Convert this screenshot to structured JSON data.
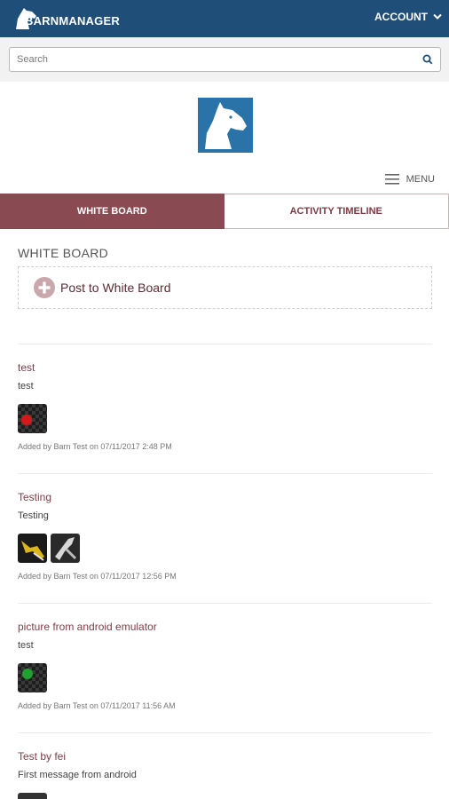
{
  "header": {
    "brand": "BARNMANAGER",
    "account_label": "ACCOUNT",
    "colors": {
      "bar": "#1f4e79"
    }
  },
  "search": {
    "placeholder": "Search",
    "value": ""
  },
  "menu": {
    "label": "MENU"
  },
  "tabs": [
    {
      "label": "WHITE BOARD",
      "active": true
    },
    {
      "label": "ACTIVITY TIMELINE",
      "active": false
    }
  ],
  "whiteboard": {
    "title": "WHITE BOARD",
    "post_button_label": "Post to White Board"
  },
  "posts": [
    {
      "title": "test",
      "body": "test",
      "attachments": [
        {
          "kind": "checker-red-dot"
        }
      ],
      "meta": "Added by Barn Test on 07/11/2017 2:48 PM"
    },
    {
      "title": "Testing",
      "body": "Testing",
      "attachments": [
        {
          "kind": "photo-yellow-tool"
        },
        {
          "kind": "photo-white-tool"
        }
      ],
      "meta": "Added by Barn Test on 07/11/2017 12:56 PM"
    },
    {
      "title": "picture from android emulator",
      "body": "test",
      "attachments": [
        {
          "kind": "checker-green-dot"
        }
      ],
      "meta": "Added by Barn Test on 07/11/2017 11:56 AM"
    },
    {
      "title": "Test by fei",
      "body": "First message from android",
      "attachments": [
        {
          "kind": "photo-partial"
        }
      ],
      "meta": ""
    }
  ],
  "colors": {
    "accent": "#8a4a52",
    "accent_text": "#7a3f48",
    "logo_bg": "#2a73a8"
  }
}
